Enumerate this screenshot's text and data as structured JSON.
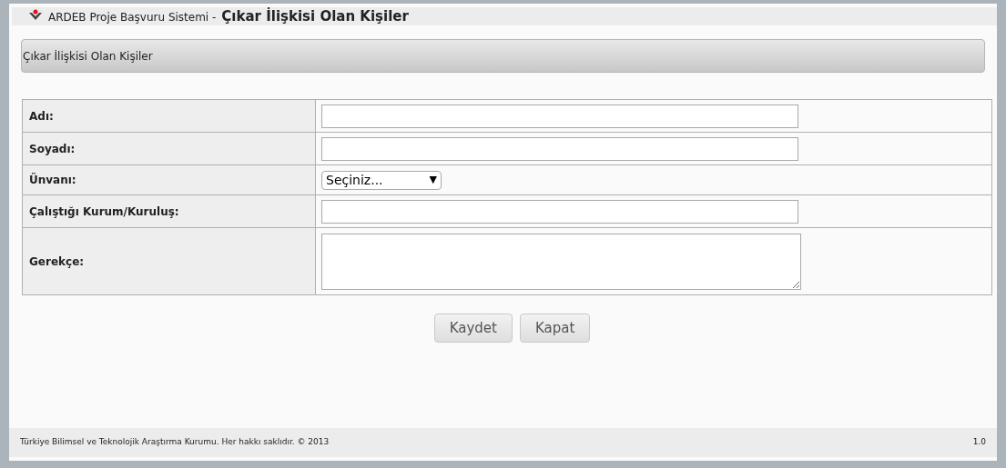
{
  "header": {
    "app_name": "ARDEB Proje Başvuru Sistemi -",
    "page_title": "Çıkar İlişkisi Olan Kişiler"
  },
  "panel": {
    "title": "Çıkar İlişkisi Olan Kişiler"
  },
  "form": {
    "rows": [
      {
        "label": "Adı:",
        "kind": "input"
      },
      {
        "label": "Soyadı:",
        "kind": "input"
      },
      {
        "label": "Ünvanı:",
        "kind": "select",
        "value": "Seçiniz...",
        "arrow": "▼"
      },
      {
        "label": "Çalıştığı Kurum/Kuruluş:",
        "kind": "input"
      },
      {
        "label": "Gerekçe:",
        "kind": "textarea"
      }
    ]
  },
  "buttons": [
    "Kaydet",
    "Kapat"
  ],
  "footer": {
    "copyright": "Türkiye Bilimsel ve Teknolojik Araştırma Kurumu. Her hakkı saklıdır. © 2013",
    "version": "1.0"
  }
}
